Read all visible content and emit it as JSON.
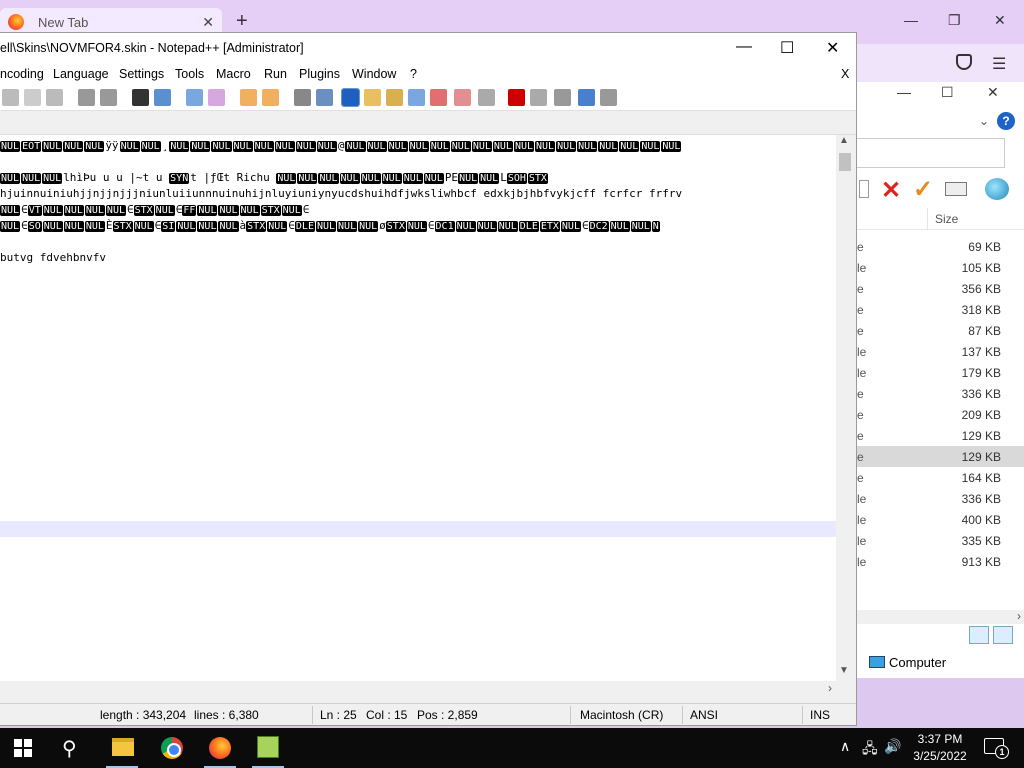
{
  "browser": {
    "tab_label": "New Tab",
    "tab_close": "✕",
    "new_tab": "+",
    "controls": {
      "minimize": "—",
      "restore": "❐",
      "close": "✕"
    },
    "menu_icon": "☰"
  },
  "explorer": {
    "controls": {
      "minimize": "—",
      "maximize": "☐",
      "close": "✕"
    },
    "chevron": "⌄",
    "help": "?",
    "column_size": "Size",
    "rows": [
      {
        "frag": "e",
        "size": "69 KB"
      },
      {
        "frag": "le",
        "size": "105 KB"
      },
      {
        "frag": "e",
        "size": "356 KB"
      },
      {
        "frag": "e",
        "size": "318 KB"
      },
      {
        "frag": "e",
        "size": "87 KB"
      },
      {
        "frag": "le",
        "size": "137 KB"
      },
      {
        "frag": "le",
        "size": "179 KB"
      },
      {
        "frag": "e",
        "size": "336 KB"
      },
      {
        "frag": "e",
        "size": "209 KB"
      },
      {
        "frag": "e",
        "size": "129 KB"
      },
      {
        "frag": "e",
        "size": "129 KB",
        "selected": true
      },
      {
        "frag": "e",
        "size": "164 KB"
      },
      {
        "frag": "le",
        "size": "336 KB"
      },
      {
        "frag": "le",
        "size": "400 KB"
      },
      {
        "frag": "le",
        "size": "335 KB"
      },
      {
        "frag": "le",
        "size": "913 KB"
      }
    ],
    "computer_label": "Computer",
    "scroll_right": "›"
  },
  "npp": {
    "title": "ell\\Skins\\NOVMFOR4.skin - Notepad++ [Administrator]",
    "controls": {
      "minimize": "—",
      "maximize": "☐",
      "close": "✕"
    },
    "menu": [
      "ncoding",
      "Language",
      "Settings",
      "Tools",
      "Macro",
      "Run",
      "Plugins",
      "Window",
      "?"
    ],
    "menu_close": "X",
    "lines": {
      "l1": [
        "NUL",
        "EOT",
        "NUL",
        "NUL",
        "NUL",
        "ÿÿ",
        "NUL",
        "NUL",
        "¸",
        "NUL",
        "NUL",
        "NUL",
        "NUL",
        "NUL",
        "NUL",
        "NUL",
        "NUL",
        "@",
        "NUL",
        "NUL",
        "NUL",
        "NUL",
        "NUL",
        "NUL",
        "NUL",
        "NUL",
        "NUL",
        "NUL",
        "NUL",
        "NUL",
        "NUL",
        "NUL",
        "NUL",
        "NUL"
      ],
      "l3_text": "lhìÞu   u    u     |~t     u    ",
      "l3_syn": "SYN",
      "l3_tail": "t      |ƒŒt    Richu   ",
      "l3_mid": "NUL NUL NUL NUL NUL NUL NUL NUL NUL",
      "l3_end": "PE",
      "l4": "hjuinnuiniuhjjnjjnjjjniunluiiunnnuinuhijnluyiuniynyucdshuihdfjwksliwhbcf edxkjbjhbfvykjcff  fcrfcr frfrv",
      "l5_a": "VT",
      "l5_b": "STX",
      "l5_c": "FF",
      "l5_d": "STX",
      "l6_a": "SO",
      "l6_b": "STX",
      "l6_c": "SI",
      "l6_d": "STX",
      "l6_e": "DLE",
      "l6_f": "STX",
      "l6_g": "DC1",
      "l6_h": "DLE",
      "l6_i": "ETX",
      "l6_j": "DC2",
      "l8": "butvg fdvehbnvfv"
    },
    "status": {
      "length": "length : 343,204",
      "lines": "lines : 6,380",
      "ln": "Ln : 25",
      "col": "Col : 15",
      "pos": "Pos : 2,859",
      "eol": "Macintosh (CR)",
      "encoding": "ANSI",
      "mode": "INS"
    }
  },
  "taskbar": {
    "time": "3:37 PM",
    "date": "3/25/2022",
    "notifications": "1",
    "tray_chevron": "∧",
    "network_icon": "🖧",
    "volume_icon": "🔊",
    "search_icon": "⚲"
  }
}
